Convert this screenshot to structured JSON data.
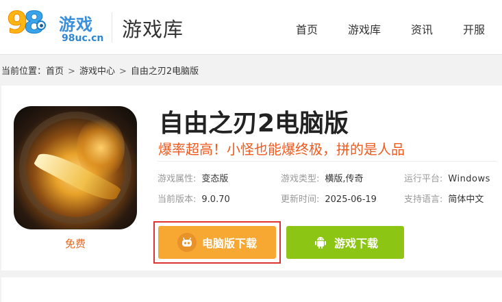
{
  "header": {
    "logo": {
      "digits": "98",
      "brand": "游戏",
      "url": "98uc.cn"
    },
    "site_title": "游戏库",
    "nav": [
      "首页",
      "游戏库",
      "资讯",
      "开服"
    ]
  },
  "breadcrumb": {
    "prefix": "当前位置：",
    "items": [
      "首页",
      "游戏中心",
      "自由之刃2电脑版"
    ],
    "separator": ">"
  },
  "game": {
    "title": "自由之刃2电脑版",
    "slogan": "爆率超高！小怪也能爆终极，拼的是人品",
    "price_label": "免费",
    "meta": [
      {
        "key": "游戏属性:",
        "value": "变态版"
      },
      {
        "key": "游戏类型:",
        "value": "横版,传奇"
      },
      {
        "key": "运行平台:",
        "value": "Windows"
      },
      {
        "key": "当前版本:",
        "value": "9.0.70"
      },
      {
        "key": "更新时间:",
        "value": "2025-06-19"
      },
      {
        "key": "支持语言:",
        "value": "简体中文"
      }
    ]
  },
  "buttons": {
    "pc_download": "电脑版下载",
    "mobile_download": "游戏下载"
  },
  "colors": {
    "accent_orange": "#f6a832",
    "accent_green": "#8cc514",
    "slogan": "#f05a1e",
    "highlight_border": "#e03030"
  },
  "icons": {
    "pc_button": "gamepad-robot-icon",
    "mobile_button": "android-icon"
  }
}
